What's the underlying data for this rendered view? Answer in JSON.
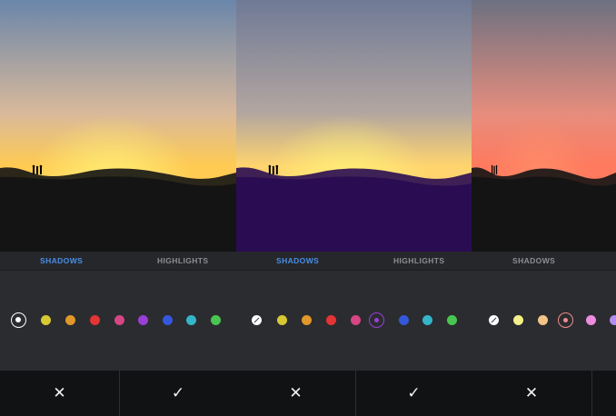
{
  "panels": [
    {
      "tabs": [
        "SHADOWS",
        "HIGHLIGHTS"
      ],
      "active_tab": 0,
      "tint": "none",
      "swatches": [
        "selected-white",
        "#d8c832",
        "#e0982a",
        "#e43434",
        "#d54682",
        "#9a3fd6",
        "#3457db",
        "#35b5c9",
        "#49c651"
      ],
      "cancel_icon": "✕",
      "confirm_icon": "✓"
    },
    {
      "tabs": [
        "SHADOWS",
        "HIGHLIGHTS"
      ],
      "active_tab": 0,
      "tint": "purple",
      "swatches": [
        "none-white",
        "#d8c832",
        "#e0982a",
        "#e43434",
        "#d54682",
        "selected-#9a3fd6",
        "#3457db",
        "#35b5c9",
        "#49c651"
      ],
      "cancel_icon": "✕",
      "confirm_icon": "✓"
    },
    {
      "tabs": [
        "SHADOWS"
      ],
      "active_tab": -1,
      "tint": "red",
      "swatches": [
        "none-white",
        "#f5ef8a",
        "#f2c487",
        "selected-#f08c8c",
        "#ee8cdf",
        "#b58bf0"
      ],
      "cancel_icon": "✕"
    }
  ],
  "colors": {
    "accent": "#4a8fe7",
    "toolbar_bg": "#26272b",
    "swatch_bg": "#2b2c30",
    "action_bg": "#111214"
  }
}
